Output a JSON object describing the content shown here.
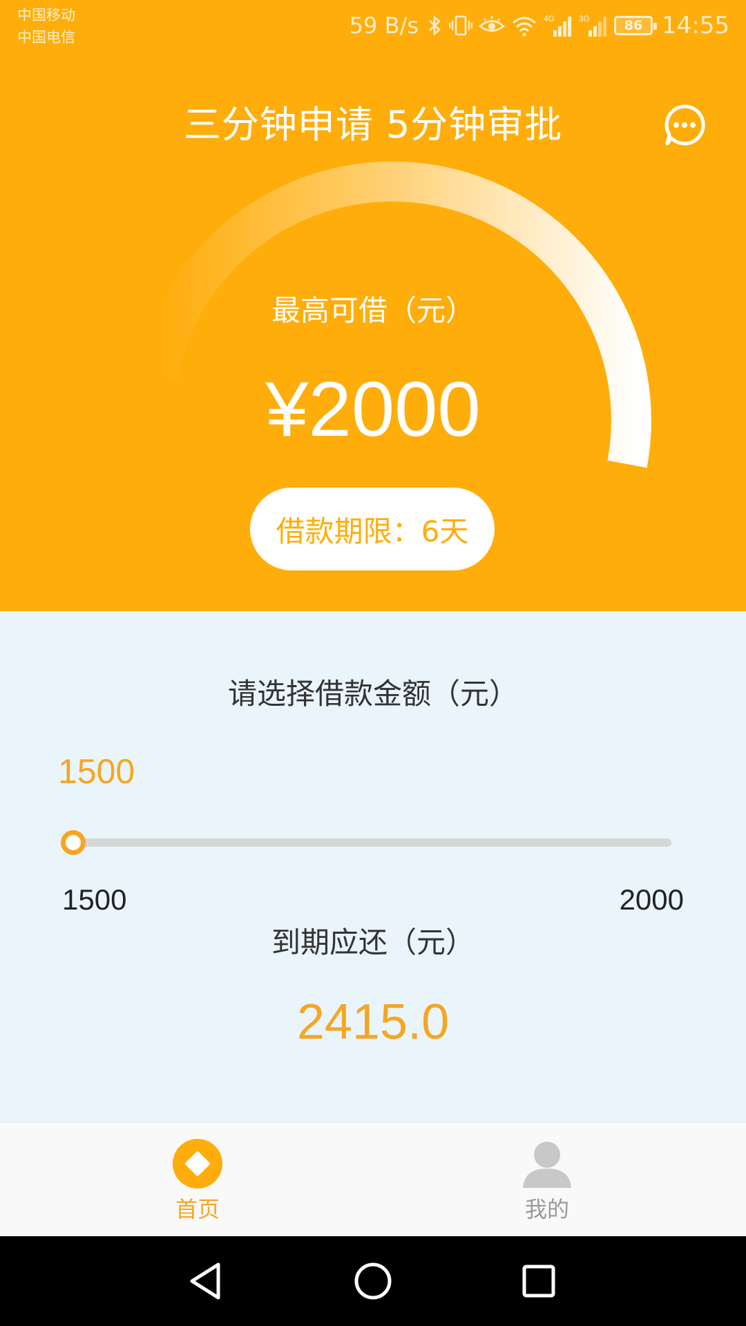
{
  "status_bar": {
    "carrier_1": "中国移动",
    "carrier_2": "中国电信",
    "net_speed": "59 B/s",
    "signal_1_label": "4G",
    "signal_2_label": "3G",
    "battery": "86",
    "time": "14:55",
    "icons": [
      "bluetooth-icon",
      "vibrate-icon",
      "eye-icon",
      "wifi-icon",
      "signal-icon",
      "battery-icon"
    ]
  },
  "header": {
    "title": "三分钟申请 5分钟审批",
    "chat_icon": "chat-bubble-icon"
  },
  "hero": {
    "max_label": "最高可借（元）",
    "max_amount": "¥2000",
    "term_label": "借款期限：6天"
  },
  "selector": {
    "title": "请选择借款金额（元）",
    "current_value": "1500",
    "slider_fraction": 0,
    "min": "1500",
    "max": "2000",
    "due_label": "到期应还（元）",
    "due_amount": "2415.0"
  },
  "tabs": [
    {
      "label": "首页",
      "icon": "home-diamond-icon",
      "active": true
    },
    {
      "label": "我的",
      "icon": "user-icon",
      "active": false
    }
  ],
  "nav": {
    "icons": [
      "back-triangle-icon",
      "home-circle-icon",
      "recent-square-icon"
    ]
  },
  "colors": {
    "accent": "#FFAD0A",
    "accent_text": "#F6A623",
    "selector_bg": "#E9F5FB",
    "tab_inactive": "#9A9A9A"
  }
}
